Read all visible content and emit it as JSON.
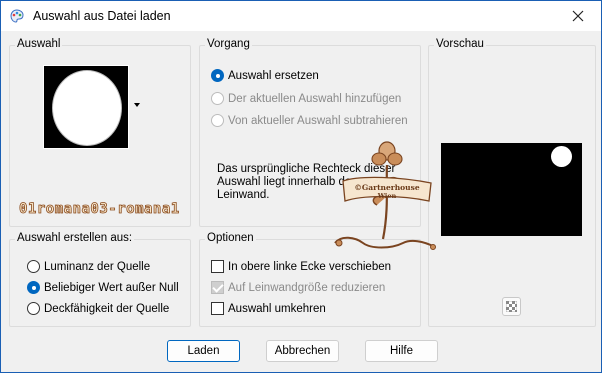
{
  "window": {
    "title": "Auswahl aus Datei laden",
    "close_icon": "close-icon",
    "app_icon": "paint-palette-icon"
  },
  "auswahl": {
    "label": "Auswahl"
  },
  "vorgang": {
    "label": "Vorgang",
    "options": [
      {
        "label": "Auswahl ersetzen",
        "selected": true,
        "disabled": false
      },
      {
        "label": "Der aktuellen Auswahl hinzufügen",
        "selected": false,
        "disabled": true
      },
      {
        "label": "Von aktueller Auswahl subtrahieren",
        "selected": false,
        "disabled": true
      }
    ],
    "info_line1": "Das ursprüngliche Rechteck dieser",
    "info_line2": "Auswahl liegt innerhalb der",
    "info_line3": "Leinwand."
  },
  "vorschau": {
    "label": "Vorschau",
    "zoom_icon": "checker-zoom-icon"
  },
  "erstellen": {
    "label": "Auswahl erstellen aus:",
    "options": [
      {
        "label": "Luminanz der Quelle",
        "selected": false
      },
      {
        "label": "Beliebiger Wert außer Null",
        "selected": true
      },
      {
        "label": "Deckfähigkeit der Quelle",
        "selected": false
      }
    ]
  },
  "optionen": {
    "label": "Optionen",
    "items": [
      {
        "label": "In obere linke Ecke verschieben",
        "checked": false,
        "disabled": false
      },
      {
        "label": "Auf Leinwandgröße reduzieren",
        "checked": true,
        "disabled": true
      },
      {
        "label": "Auswahl umkehren",
        "checked": false,
        "disabled": false
      }
    ]
  },
  "buttons": {
    "laden": "Laden",
    "abbrechen": "Abbrechen",
    "hilfe": "Hilfe"
  },
  "watermark": {
    "text": "01romana03-romana1",
    "logo_text": "©Gartnerhouse Wien"
  }
}
